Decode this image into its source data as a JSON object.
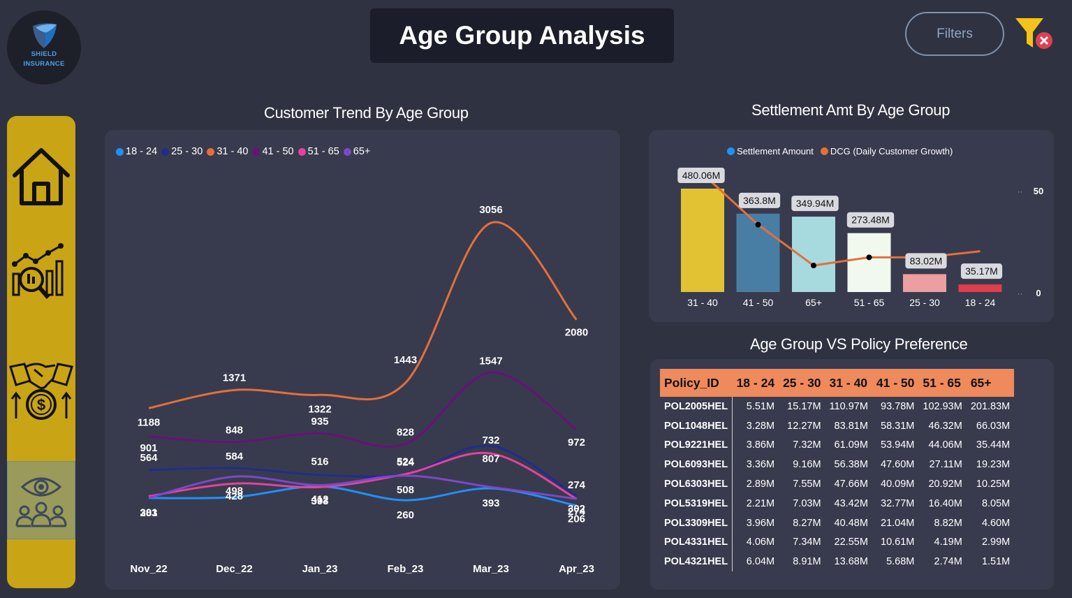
{
  "logo": {
    "line1": "SHIELD",
    "line2": "INSURANCE"
  },
  "header": {
    "title": "Age Group Analysis",
    "filters_label": "Filters",
    "clear_filter_icon": "funnel-clear-icon"
  },
  "sidebar": {
    "items": [
      {
        "icon": "home-icon",
        "active": false
      },
      {
        "icon": "analytics-chart-icon",
        "active": false
      },
      {
        "icon": "handshake-money-icon",
        "active": false
      },
      {
        "icon": "eye-group-icon",
        "active": true
      }
    ]
  },
  "colors": {
    "background": "#2f3241",
    "panel": "#383b4d",
    "sidebar": "#c9a414",
    "18-24": "#1e90ff",
    "25-30": "#1f2d8c",
    "31-40": "#e56f3a",
    "41-50": "#6a1178",
    "51-65": "#e3439f",
    "65+": "#7b48c9"
  },
  "trend": {
    "title": "Customer Trend By Age Group",
    "chart_data": {
      "type": "line",
      "x": [
        "Nov_22",
        "Dec_22",
        "Jan_23",
        "Feb_23",
        "Mar_23",
        "Apr_23"
      ],
      "series": [
        {
          "name": "18 - 24",
          "color": "#1e90ff",
          "values": [
            null,
            null,
            null,
            260,
            null,
            206
          ]
        },
        {
          "name": "25 - 30",
          "color": "#1f2d8c",
          "values": [
            564,
            584,
            516,
            524,
            807,
            302
          ]
        },
        {
          "name": "31 - 40",
          "color": "#e56f3a",
          "values": [
            1188,
            1371,
            1322,
            1443,
            3056,
            2080
          ]
        },
        {
          "name": "41 - 50",
          "color": "#6a1178",
          "values": [
            901,
            848,
            935,
            828,
            1547,
            972
          ]
        },
        {
          "name": "51 - 65",
          "color": "#e3439f",
          "values": [
            301,
            428,
            393,
            524,
            732,
            274
          ]
        },
        {
          "name": "65+",
          "color": "#7b48c9",
          "values": [
            283,
            498,
            412,
            508,
            393,
            274
          ]
        }
      ],
      "ylim": [
        0,
        3500
      ],
      "legend": "top-left",
      "grid": false
    }
  },
  "settlement": {
    "title": "Settlement Amt By Age Group",
    "chart_data": {
      "type": "bar",
      "categories": [
        "31 - 40",
        "41 - 50",
        "65+",
        "51 - 65",
        "25 - 30",
        "18 - 24"
      ],
      "series": [
        {
          "name": "Settlement Amount",
          "color": "#1e90ff",
          "values": [
            480.06,
            363.8,
            349.94,
            273.48,
            83.02,
            35.17
          ],
          "labels": [
            "480.06M",
            "363.8M",
            "349.94M",
            "273.48M",
            "83.02M",
            "35.17M"
          ]
        },
        {
          "name": "DCG (Daily Customer Growth)",
          "color": "#e56f3a",
          "values": [
            58,
            33,
            13,
            17,
            null,
            null
          ]
        }
      ],
      "bar_colors": [
        "#e2c232",
        "#497ea4",
        "#a6dadf",
        "#f1f9ef",
        "#ec9ea0",
        "#e23d4c"
      ],
      "ylim": [
        0,
        500
      ],
      "y2_ticks": [
        "50",
        "0"
      ],
      "legend": "top-center",
      "grid": false
    }
  },
  "policy": {
    "title": "Age Group VS Policy Preference",
    "columns": [
      "Policy_ID",
      "18 - 24",
      "25 - 30",
      "31 - 40",
      "41 - 50",
      "51 - 65",
      "65+"
    ],
    "rows": [
      [
        "POL2005HEL",
        "5.51M",
        "15.17M",
        "110.97M",
        "93.78M",
        "102.93M",
        "201.83M"
      ],
      [
        "POL1048HEL",
        "3.28M",
        "12.27M",
        "83.81M",
        "58.31M",
        "46.32M",
        "66.03M"
      ],
      [
        "POL9221HEL",
        "3.86M",
        "7.32M",
        "61.09M",
        "53.94M",
        "44.06M",
        "35.44M"
      ],
      [
        "POL6093HEL",
        "3.36M",
        "9.16M",
        "56.38M",
        "47.60M",
        "27.11M",
        "19.23M"
      ],
      [
        "POL6303HEL",
        "2.89M",
        "7.55M",
        "47.66M",
        "40.09M",
        "20.92M",
        "10.25M"
      ],
      [
        "POL5319HEL",
        "2.21M",
        "7.03M",
        "43.42M",
        "32.77M",
        "16.40M",
        "8.05M"
      ],
      [
        "POL3309HEL",
        "3.96M",
        "8.27M",
        "40.48M",
        "21.04M",
        "8.82M",
        "4.60M"
      ],
      [
        "POL4331HEL",
        "4.06M",
        "7.34M",
        "22.55M",
        "10.61M",
        "4.19M",
        "2.99M"
      ],
      [
        "POL4321HEL",
        "6.04M",
        "8.91M",
        "13.68M",
        "5.68M",
        "2.74M",
        "1.51M"
      ]
    ]
  }
}
